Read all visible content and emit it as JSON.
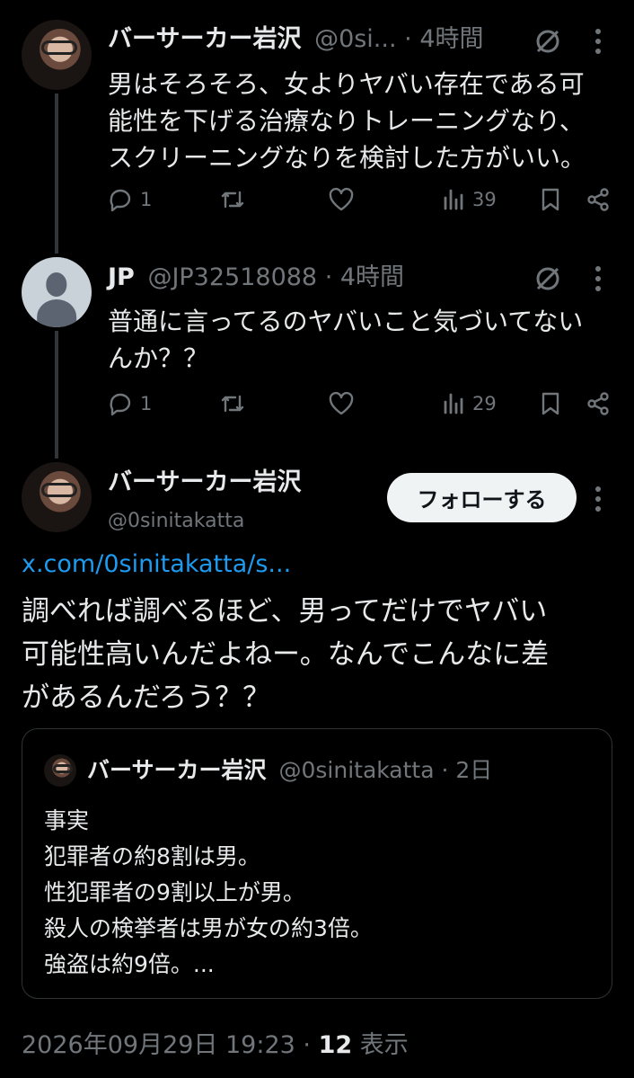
{
  "tweet1": {
    "name": "バーサーカー岩沢",
    "handle": "@0si...",
    "time": "4時間",
    "text_lines": [
      "男はそろそろ、女よりヤバい存在である可",
      "能性を下げる治療なりトレーニングなり、",
      "スクリーニングなりを検討した方がいい。"
    ],
    "replies": "1",
    "views": "39"
  },
  "tweet2": {
    "name": "JP",
    "handle": "@JP32518088",
    "time": "4時間",
    "text_lines": [
      "普通に言ってるのヤバいこと気づいてない",
      "んか？？"
    ],
    "replies": "1",
    "views": "29"
  },
  "main": {
    "name": "バーサーカー岩沢",
    "handle": "@0sinitakatta",
    "follow_label": "フォローする",
    "link": "x.com/0sinitakatta/s...",
    "text_lines": [
      "調べれば調べるほど、男ってだけでヤバい",
      "可能性高いんだよねー。なんでこんなに差",
      "があるんだろう？？"
    ]
  },
  "quote": {
    "name": "バーサーカー岩沢",
    "handle": "@0sinitakatta",
    "time": "2日",
    "lines": [
      "事実",
      "犯罪者の約8割は男。",
      "性犯罪者の9割以上が男。",
      "殺人の検挙者は男が女の約3倍。",
      "強盗は約9倍。..."
    ]
  },
  "footer": {
    "datetime": "2026年09月29日 19:23",
    "view_count": "12",
    "view_label": "表示"
  },
  "icons": [
    "more-icon",
    "grok-icon",
    "reply-icon",
    "repost-icon",
    "like-icon",
    "views-icon",
    "bookmark-icon",
    "share-icon"
  ],
  "colors": {
    "link": "#1d9bf0",
    "muted": "#71767b",
    "text": "#e7e9ea",
    "background": "#000000"
  }
}
